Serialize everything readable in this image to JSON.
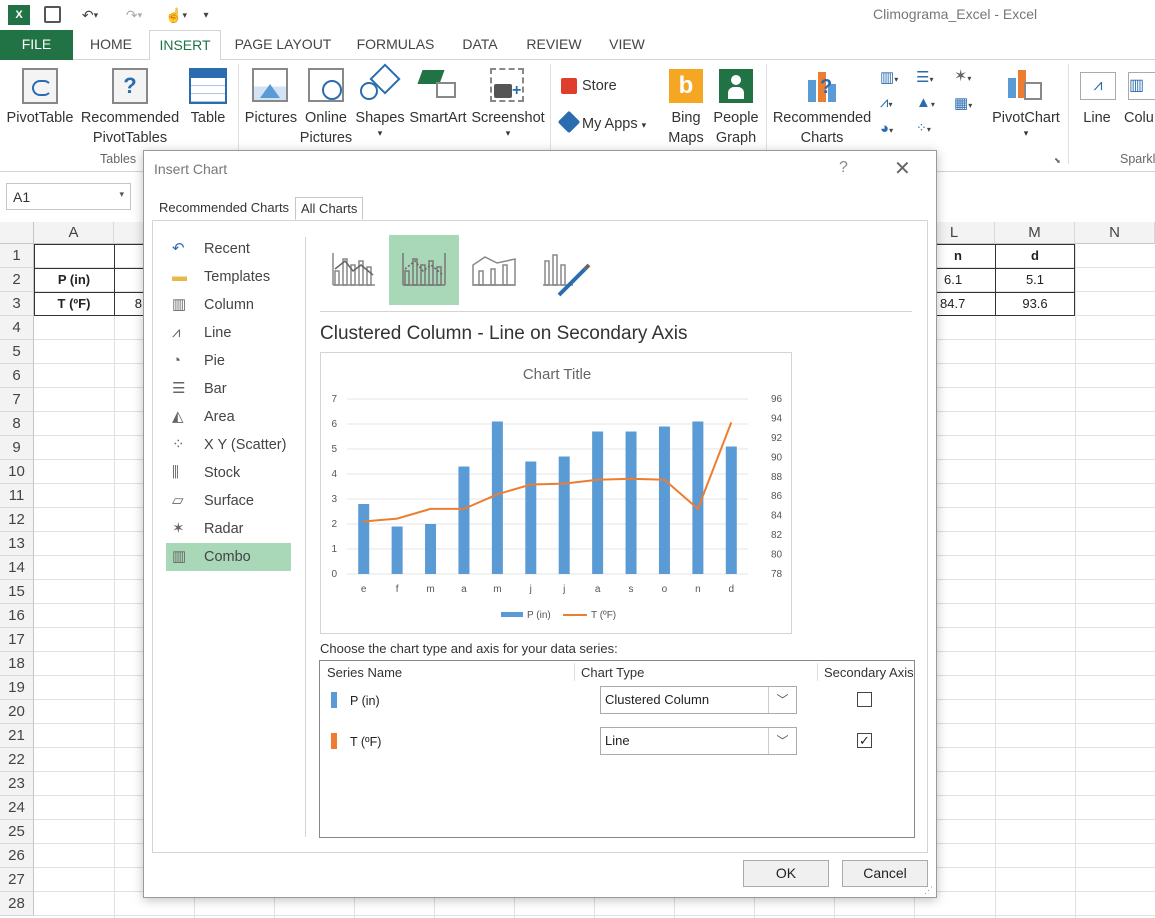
{
  "window": {
    "title": "Climograma_Excel - Excel"
  },
  "qat": {
    "undo_icon": "undo-icon",
    "redo_icon": "redo-icon",
    "touch_icon": "touch-mode-icon"
  },
  "tabs": [
    {
      "label": "FILE"
    },
    {
      "label": "HOME"
    },
    {
      "label": "INSERT"
    },
    {
      "label": "PAGE LAYOUT"
    },
    {
      "label": "FORMULAS"
    },
    {
      "label": "DATA"
    },
    {
      "label": "REVIEW"
    },
    {
      "label": "VIEW"
    }
  ],
  "ribbon": {
    "pivottable": "PivotTable",
    "rec_pivot_1": "Recommended",
    "rec_pivot_2": "PivotTables",
    "table": "Table",
    "tables_group": "Tables",
    "pictures": "Pictures",
    "online_1": "Online",
    "online_2": "Pictures",
    "shapes": "Shapes",
    "smartart": "SmartArt",
    "screenshot": "Screenshot",
    "store": "Store",
    "myapps": "My Apps",
    "bing_1": "Bing",
    "bing_2": "Maps",
    "people_1": "People",
    "people_2": "Graph",
    "rec_charts_1": "Recommended",
    "rec_charts_2": "Charts",
    "pivotchart": "PivotChart",
    "line": "Line",
    "column": "Colu",
    "sparklines_group": "Sparkl"
  },
  "namebox": {
    "value": "A1"
  },
  "columns": [
    "A",
    "L",
    "M",
    "N"
  ],
  "rows": [
    "1",
    "2",
    "3",
    "4",
    "5",
    "6",
    "7",
    "8",
    "9",
    "10",
    "11",
    "12",
    "13",
    "14",
    "15",
    "16",
    "17",
    "18",
    "19",
    "20",
    "21",
    "22",
    "23",
    "24",
    "25",
    "26",
    "27",
    "28"
  ],
  "cells": {
    "L1": "n",
    "M1": "d",
    "A2": "P (in)",
    "L2": "6.1",
    "M2": "5.1",
    "A3": "T (ºF)",
    "L3": "84.7",
    "M3": "93.6",
    "B3": "8"
  },
  "dialog": {
    "title": "Insert Chart",
    "help": "?",
    "tab_recommended": "Recommended Charts",
    "tab_all": "All Charts",
    "categories": [
      "Recent",
      "Templates",
      "Column",
      "Line",
      "Pie",
      "Bar",
      "Area",
      "X Y (Scatter)",
      "Stock",
      "Surface",
      "Radar",
      "Combo"
    ],
    "selected_category": "Combo",
    "subtype_title": "Clustered Column - Line on Secondary Axis",
    "choose_text": "Choose the chart type and axis for your data series:",
    "col_series_name": "Series Name",
    "col_chart_type": "Chart Type",
    "col_secondary": "Secondary Axis",
    "series": [
      {
        "name": "P (in)",
        "type": "Clustered Column",
        "secondary": false,
        "color": "#5B9BD5"
      },
      {
        "name": "T (ºF)",
        "type": "Line",
        "secondary": true,
        "color": "#ED7D31"
      }
    ],
    "ok": "OK",
    "cancel": "Cancel"
  },
  "chart_data": {
    "type": "bar",
    "title": "Chart Title",
    "categories": [
      "e",
      "f",
      "m",
      "a",
      "m",
      "j",
      "j",
      "a",
      "s",
      "o",
      "n",
      "d"
    ],
    "series": [
      {
        "name": "P (in)",
        "type": "bar",
        "axis": "primary",
        "color": "#5B9BD5",
        "values": [
          2.8,
          1.9,
          2.0,
          4.3,
          6.1,
          4.5,
          4.7,
          5.7,
          5.7,
          5.9,
          6.1,
          5.1
        ]
      },
      {
        "name": "T (ºF)",
        "type": "line",
        "axis": "secondary",
        "color": "#ED7D31",
        "values": [
          83.4,
          83.7,
          84.7,
          84.7,
          86.2,
          87.2,
          87.3,
          87.7,
          87.8,
          87.7,
          84.7,
          93.6
        ]
      }
    ],
    "ylim": [
      0,
      7
    ],
    "y2lim": [
      78,
      96
    ],
    "yticks": [
      "0",
      "1",
      "2",
      "3",
      "4",
      "5",
      "6",
      "7"
    ],
    "y2ticks": [
      "78",
      "80",
      "82",
      "84",
      "86",
      "88",
      "90",
      "92",
      "94",
      "96"
    ],
    "legend": "bottom",
    "grid": true
  }
}
